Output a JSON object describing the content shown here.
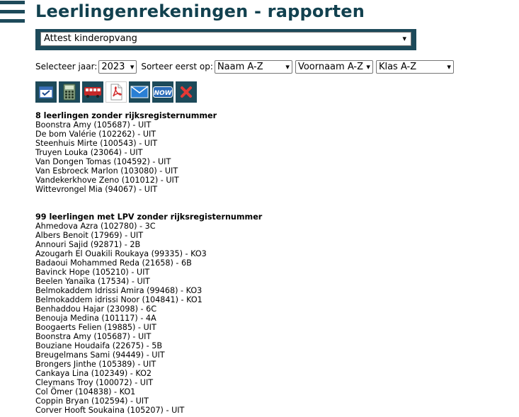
{
  "page": {
    "title": "Leerlingenrekeningen - rapporten"
  },
  "report": {
    "selected": "Attest kinderopvang"
  },
  "filters": {
    "year_label": "Selecteer jaar:",
    "year_value": "2023",
    "sort_label": "Sorteer eerst op:",
    "sort1": "Naam A-Z",
    "sort2": "Voornaam A-Z",
    "sort3": "Klas A-Z"
  },
  "toolbar": {
    "icons": [
      "checklist-icon",
      "calculator-icon",
      "bus-icon",
      "pdf-icon",
      "mail-icon",
      "now-icon",
      "close-icon"
    ],
    "now_label": "NOW"
  },
  "section1": {
    "title": "8 leerlingen zonder rijksregisternummer",
    "items": [
      "Boonstra Amy (105687) - UIT",
      "De bom Valérie (102262) - UIT",
      "Steenhuis Mirte (100543) - UIT",
      "Truyen Louka (23064) - UIT",
      "Van Dongen Tomas (104592) - UIT",
      "Van Esbroeck Marlon (103080) - UIT",
      "Vandekerkhove Zeno (101012) - UIT",
      "Wittevrongel Mia (94067) - UIT"
    ]
  },
  "section2": {
    "title": "99 leerlingen met LPV zonder rijksregisternummer",
    "items": [
      "Ahmedova Azra (102780) - 3C",
      "Albers Benoit (17969) - UIT",
      "Annouri Sajid (92871) - 2B",
      "Azougarh El Ouakili Roukaya (99335) - KO3",
      "Badaoui Mohammed Reda (21658) - 6B",
      "Bavinck Hope (105210) - UIT",
      "Beelen Yanaïka (17534) - UIT",
      "Belmokaddem Idrissi Amira (99468) - KO3",
      "Belmokaddem idrissi Noor (104841) - KO1",
      "Benhaddou Hajar (23098) - 6C",
      "Benouja Medina (101117) - 4A",
      "Boogaerts Felien (19885) - UIT",
      "Boonstra Amy (105687) - UIT",
      "Bouziane Houdaifa (22675) - 5B",
      "Breugelmans Sami (94449) - UIT",
      "Brongers Jinthe (105389) - UIT",
      "Cankaya Lina (102349) - KO2",
      "Cleymans Troy (100072) - UIT",
      "Col Ömer (104838) - KO1",
      "Coppin Bryan (102594) - UIT",
      "Corver Hooft Soukaina (105207) - UIT"
    ]
  }
}
